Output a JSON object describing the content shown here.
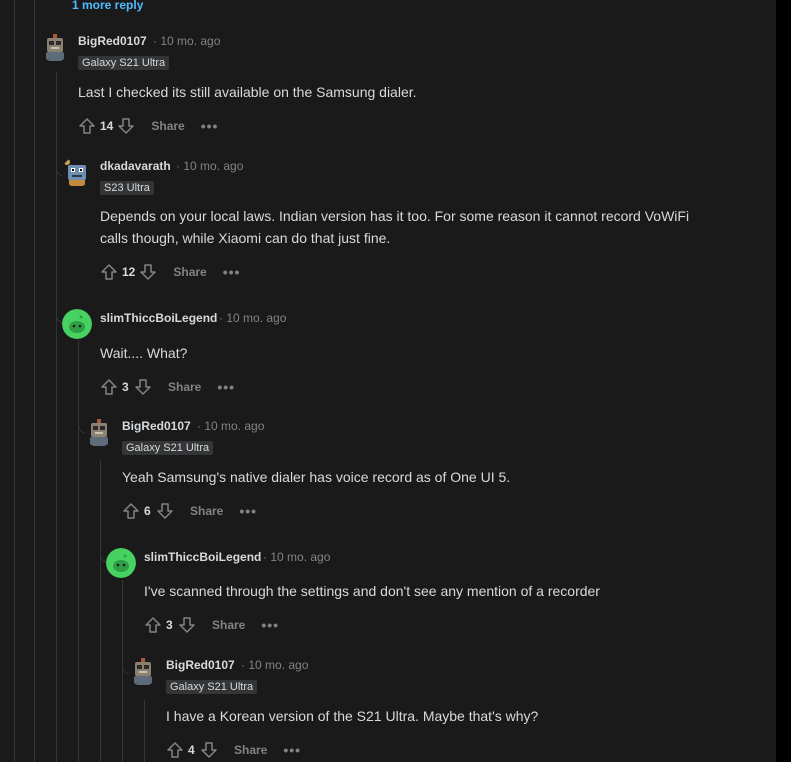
{
  "thread": {
    "more_replies": "1 more reply",
    "share_label": "Share",
    "more_icon": "•••",
    "comments": [
      {
        "author": "BigRed0107",
        "age": "10 mo. ago",
        "flair": "Galaxy S21 Ultra",
        "body": "Last I checked its still available on the Samsung dialer.",
        "votes": "14"
      },
      {
        "author": "dkadavarath",
        "age": "10 mo. ago",
        "flair": "S23 Ultra",
        "body": "Depends on your local laws. Indian version has it too. For some reason it cannot record VoWiFi calls though, while Xiaomi can do that just fine.",
        "votes": "12"
      },
      {
        "author": "slimThiccBoiLegend",
        "age": "10 mo. ago",
        "body": "Wait.... What?",
        "votes": "3"
      },
      {
        "author": "BigRed0107",
        "age": "10 mo. ago",
        "flair": "Galaxy S21 Ultra",
        "body": "Yeah Samsung's native dialer has voice record as of One UI 5.",
        "votes": "6"
      },
      {
        "author": "slimThiccBoiLegend",
        "age": "10 mo. ago",
        "body": "I've scanned through the settings and don't see any mention of a recorder",
        "votes": "3"
      },
      {
        "author": "BigRed0107",
        "age": "10 mo. ago",
        "flair": "Galaxy S21 Ultra",
        "body": "I have a Korean version of the S21 Ultra. Maybe that's why?",
        "votes": "4"
      }
    ]
  },
  "colors": {
    "background": "#1a1a1b",
    "text": "#d7dadc",
    "muted": "#818384",
    "link": "#4fbcff",
    "flair_bg": "#343536",
    "snoo_green": "#46d160"
  }
}
